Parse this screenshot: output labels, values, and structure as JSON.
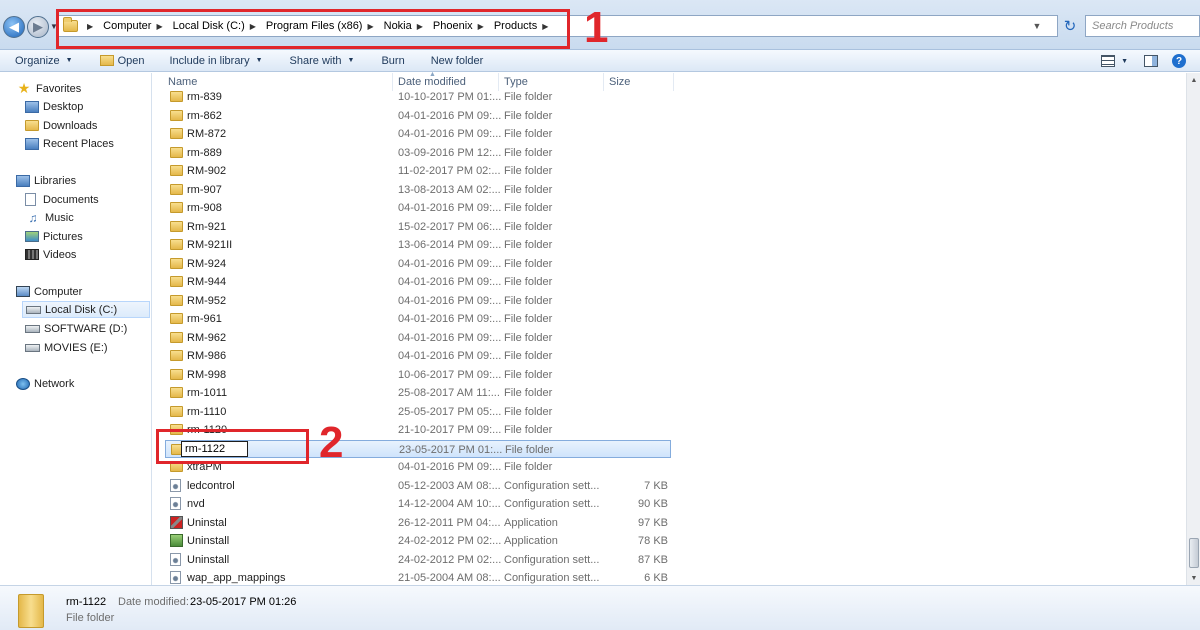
{
  "address": {
    "crumbs": [
      "Computer",
      "Local Disk (C:)",
      "Program Files (x86)",
      "Nokia",
      "Phoenix",
      "Products"
    ],
    "search_placeholder": "Search Products"
  },
  "annotations": {
    "one": "1",
    "two": "2"
  },
  "toolbar": {
    "organize": "Organize",
    "open": "Open",
    "include": "Include in library",
    "share": "Share with",
    "burn": "Burn",
    "new_folder": "New folder"
  },
  "nav": {
    "favorites": "Favorites",
    "desktop": "Desktop",
    "downloads": "Downloads",
    "recent": "Recent Places",
    "libraries": "Libraries",
    "documents": "Documents",
    "music": "Music",
    "pictures": "Pictures",
    "videos": "Videos",
    "computer": "Computer",
    "local_disk": "Local Disk (C:)",
    "software": "SOFTWARE (D:)",
    "movies": "MOVIES (E:)",
    "network": "Network"
  },
  "columns": {
    "name": "Name",
    "date": "Date modified",
    "type": "Type",
    "size": "Size"
  },
  "files": [
    {
      "name": "rm-839",
      "date": "10-10-2017 PM 01:...",
      "type": "File folder",
      "size": "",
      "icon": "folder"
    },
    {
      "name": "rm-862",
      "date": "04-01-2016 PM 09:...",
      "type": "File folder",
      "size": "",
      "icon": "folder"
    },
    {
      "name": "RM-872",
      "date": "04-01-2016 PM 09:...",
      "type": "File folder",
      "size": "",
      "icon": "folder"
    },
    {
      "name": "rm-889",
      "date": "03-09-2016 PM 12:...",
      "type": "File folder",
      "size": "",
      "icon": "folder"
    },
    {
      "name": "RM-902",
      "date": "11-02-2017 PM 02:...",
      "type": "File folder",
      "size": "",
      "icon": "folder"
    },
    {
      "name": "rm-907",
      "date": "13-08-2013 AM 02:...",
      "type": "File folder",
      "size": "",
      "icon": "folder"
    },
    {
      "name": "rm-908",
      "date": "04-01-2016 PM 09:...",
      "type": "File folder",
      "size": "",
      "icon": "folder"
    },
    {
      "name": "Rm-921",
      "date": "15-02-2017 PM 06:...",
      "type": "File folder",
      "size": "",
      "icon": "folder"
    },
    {
      "name": "RM-921II",
      "date": "13-06-2014 PM 09:...",
      "type": "File folder",
      "size": "",
      "icon": "folder"
    },
    {
      "name": "RM-924",
      "date": "04-01-2016 PM 09:...",
      "type": "File folder",
      "size": "",
      "icon": "folder"
    },
    {
      "name": "RM-944",
      "date": "04-01-2016 PM 09:...",
      "type": "File folder",
      "size": "",
      "icon": "folder"
    },
    {
      "name": "RM-952",
      "date": "04-01-2016 PM 09:...",
      "type": "File folder",
      "size": "",
      "icon": "folder"
    },
    {
      "name": "rm-961",
      "date": "04-01-2016 PM 09:...",
      "type": "File folder",
      "size": "",
      "icon": "folder"
    },
    {
      "name": "RM-962",
      "date": "04-01-2016 PM 09:...",
      "type": "File folder",
      "size": "",
      "icon": "folder"
    },
    {
      "name": "RM-986",
      "date": "04-01-2016 PM 09:...",
      "type": "File folder",
      "size": "",
      "icon": "folder"
    },
    {
      "name": "RM-998",
      "date": "10-06-2017 PM 09:...",
      "type": "File folder",
      "size": "",
      "icon": "folder"
    },
    {
      "name": "rm-1011",
      "date": "25-08-2017 AM 11:...",
      "type": "File folder",
      "size": "",
      "icon": "folder"
    },
    {
      "name": "rm-1110",
      "date": "25-05-2017 PM 05:...",
      "type": "File folder",
      "size": "",
      "icon": "folder"
    },
    {
      "name": "rm-1120",
      "date": "21-10-2017 PM 09:...",
      "type": "File folder",
      "size": "",
      "icon": "folder"
    },
    {
      "name": "rm-1122",
      "date": "23-05-2017 PM 01:...",
      "type": "File folder",
      "size": "",
      "icon": "folder",
      "selected": true
    },
    {
      "name": "xtraPM",
      "date": "04-01-2016 PM 09:...",
      "type": "File folder",
      "size": "",
      "icon": "folder"
    },
    {
      "name": "ledcontrol",
      "date": "05-12-2003 AM 08:...",
      "type": "Configuration sett...",
      "size": "7 KB",
      "icon": "settings"
    },
    {
      "name": "nvd",
      "date": "14-12-2004 AM 10:...",
      "type": "Configuration sett...",
      "size": "90 KB",
      "icon": "settings"
    },
    {
      "name": "Uninstal",
      "date": "26-12-2011 PM 04:...",
      "type": "Application",
      "size": "97 KB",
      "icon": "app"
    },
    {
      "name": "Uninstall",
      "date": "24-02-2012 PM 02:...",
      "type": "Application",
      "size": "78 KB",
      "icon": "installer"
    },
    {
      "name": "Uninstall",
      "date": "24-02-2012 PM 02:...",
      "type": "Configuration sett...",
      "size": "87 KB",
      "icon": "settings"
    },
    {
      "name": "wap_app_mappings",
      "date": "21-05-2004 AM 08:...",
      "type": "Configuration sett...",
      "size": "6 KB",
      "icon": "settings"
    }
  ],
  "rename_value": "rm-1122",
  "details": {
    "name": "rm-1122",
    "modified_label": "Date modified:",
    "modified_value": "23-05-2017 PM 01:26",
    "type": "File folder"
  }
}
